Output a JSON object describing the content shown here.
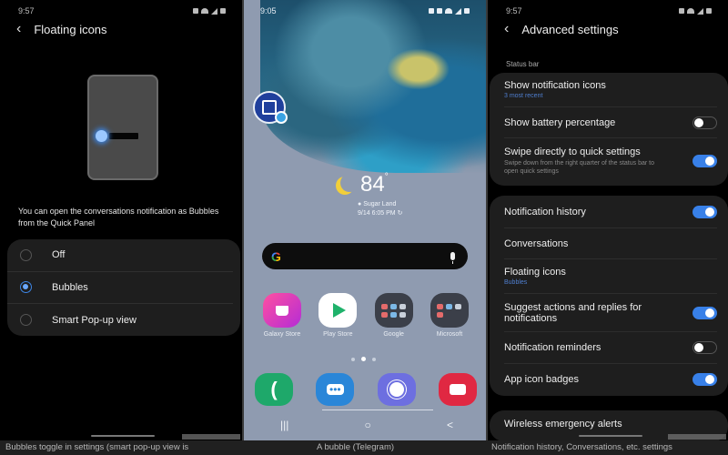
{
  "panel_left": {
    "status_time": "9:57",
    "title": "Floating icons",
    "description": "You can open the conversations notification as Bubbles from the Quick Panel",
    "options": [
      {
        "label": "Off",
        "selected": false
      },
      {
        "label": "Bubbles",
        "selected": true
      },
      {
        "label": "Smart Pop-up view",
        "selected": false
      }
    ]
  },
  "panel_middle": {
    "status_time": "9:05",
    "bubble_app": "Telegram",
    "weather": {
      "icon": "moon-icon",
      "temperature": "84",
      "unit": "°",
      "location": "Sugar Land",
      "updated": "9/14 6:05 PM"
    },
    "search": {
      "logo": "G",
      "mic_icon": "mic-icon"
    },
    "apps": [
      {
        "label": "Galaxy Store",
        "icon": "galaxy-store-icon"
      },
      {
        "label": "Play Store",
        "icon": "play-store-icon"
      },
      {
        "label": "Google",
        "icon": "google-folder-icon"
      },
      {
        "label": "Microsoft",
        "icon": "microsoft-folder-icon"
      }
    ],
    "page_dots": {
      "count": 3,
      "active": 2
    },
    "dock": [
      {
        "icon": "phone-icon"
      },
      {
        "icon": "messages-icon"
      },
      {
        "icon": "internet-icon"
      },
      {
        "icon": "camera-icon"
      }
    ],
    "nav": {
      "recents": "|||",
      "home": "○",
      "back": "<"
    }
  },
  "panel_right": {
    "status_time": "9:57",
    "title": "Advanced settings",
    "section": "Status bar",
    "group1": [
      {
        "title": "Show notification icons",
        "subtitle": "3 most recent",
        "toggle": null
      },
      {
        "title": "Show battery percentage",
        "subtitle": "",
        "toggle": false
      },
      {
        "title": "Swipe directly to quick settings",
        "subtitle": "Swipe down from the right quarter of the status bar to open quick settings",
        "toggle": true
      }
    ],
    "group2": [
      {
        "title": "Notification history",
        "subtitle": "",
        "toggle": true
      },
      {
        "title": "Conversations",
        "subtitle": "",
        "toggle": null
      },
      {
        "title": "Floating icons",
        "subtitle": "Bubbles",
        "toggle": null
      },
      {
        "title": "Suggest actions and replies for notifications",
        "subtitle": "",
        "toggle": true
      },
      {
        "title": "Notification reminders",
        "subtitle": "",
        "toggle": false
      },
      {
        "title": "App icon badges",
        "subtitle": "",
        "toggle": true
      }
    ],
    "group3": [
      {
        "title": "Wireless emergency alerts"
      }
    ]
  },
  "captions": [
    "Bubbles toggle in settings (smart pop-up view is",
    "A bubble (Telegram)",
    "Notification history, Conversations, etc. settings"
  ],
  "colors": {
    "accent": "#3880e8",
    "bg_dark": "#000000",
    "card": "#1e1e1e"
  }
}
